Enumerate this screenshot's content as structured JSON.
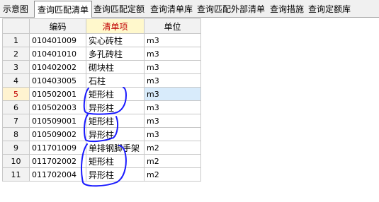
{
  "tabs": [
    {
      "label": "示意图",
      "active": false
    },
    {
      "label": "查询匹配清单",
      "active": true
    },
    {
      "label": "查询匹配定额",
      "active": false
    },
    {
      "label": "查询清单库",
      "active": false
    },
    {
      "label": "查询匹配外部清单",
      "active": false
    },
    {
      "label": "查询措施",
      "active": false
    },
    {
      "label": "查询定额库",
      "active": false
    }
  ],
  "grid": {
    "columns": [
      "",
      "编码",
      "清单项",
      "单位"
    ],
    "selected_row": 5,
    "rows": [
      {
        "n": "1",
        "code": "010401009",
        "name": "实心砖柱",
        "unit": "m3"
      },
      {
        "n": "2",
        "code": "010401010",
        "name": "多孔砖柱",
        "unit": "m3"
      },
      {
        "n": "3",
        "code": "010402002",
        "name": "砌块柱",
        "unit": "m3"
      },
      {
        "n": "4",
        "code": "010403005",
        "name": "石柱",
        "unit": "m3"
      },
      {
        "n": "5",
        "code": "010502001",
        "name": "矩形柱",
        "unit": "m3"
      },
      {
        "n": "6",
        "code": "010502003",
        "name": "异形柱",
        "unit": "m3"
      },
      {
        "n": "7",
        "code": "010509001",
        "name": "矩形柱",
        "unit": "m3"
      },
      {
        "n": "8",
        "code": "010509002",
        "name": "异形柱",
        "unit": "m3"
      },
      {
        "n": "9",
        "code": "011701009",
        "name": "单排钢脚手架",
        "unit": "m2"
      },
      {
        "n": "10",
        "code": "011702002",
        "name": "矩形柱",
        "unit": "m2"
      },
      {
        "n": "11",
        "code": "011702004",
        "name": "异形柱",
        "unit": "m2"
      }
    ]
  },
  "annotation": {
    "color": "#1a1aff"
  }
}
